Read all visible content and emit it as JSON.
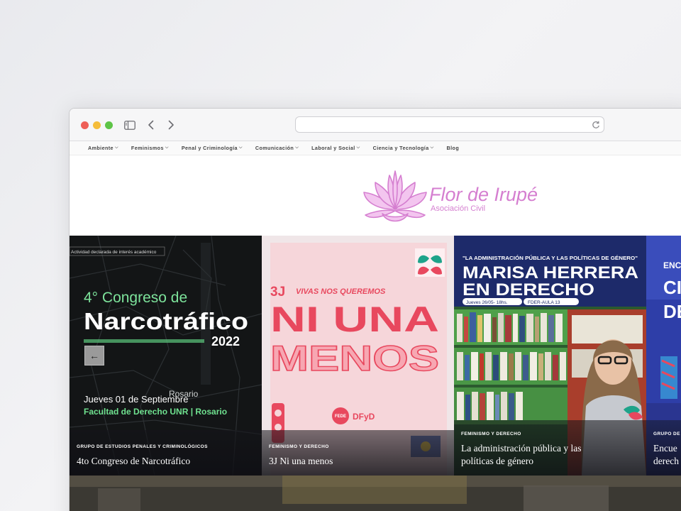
{
  "browser": {
    "url_placeholder": ""
  },
  "nav": {
    "items": [
      {
        "label": "Ambiente",
        "dropdown": true
      },
      {
        "label": "Feminismos",
        "dropdown": true
      },
      {
        "label": "Penal y Criminología",
        "dropdown": true
      },
      {
        "label": "Comunicación",
        "dropdown": true
      },
      {
        "label": "Laboral y Social",
        "dropdown": true
      },
      {
        "label": "Ciencia y Tecnología",
        "dropdown": true
      },
      {
        "label": "Blog",
        "dropdown": false
      }
    ]
  },
  "header": {
    "logo_title": "Flor de Irupé",
    "logo_subtitle": "Asociación Civil"
  },
  "cards": [
    {
      "badge": "Actividad declarada de interés académico",
      "poster_line1": "4° Congreso de",
      "poster_line2": "Narcotráfico",
      "poster_year": "2022",
      "poster_date": "Jueves 01 de Septiembre",
      "poster_place": "Facultad de Derecho UNR | Rosario",
      "map_city": "Rosario",
      "category": "GRUPO DE ESTUDIOS PENALES Y CRIMINOLÓGICOS",
      "title": "4to Congreso de Narcotráfico"
    },
    {
      "poster_tag": "3J",
      "poster_sub": "VIVAS NOS QUEREMOS",
      "poster_line1": "NI UNA",
      "poster_line2": "MENOS",
      "poster_logo1": "FEDE",
      "poster_logo2": "DFyD",
      "category": "FEMINISMO Y DERECHO",
      "title": "3J Ni una menos"
    },
    {
      "poster_header": "\"LA ADMINISTRACIÓN PÚBLICA Y LAS POLÍTICAS DE GÉNERO\"",
      "poster_line1": "MARISA HERRERA",
      "poster_line2": "EN DERECHO",
      "poster_date": "Jueves 26/05- 18hs.",
      "poster_place": "FDER-AULA 13",
      "category": "FEMINISMO Y DERECHO",
      "title_line1": "La administración pública y las",
      "title_line2": "políticas de género"
    },
    {
      "poster_line1": "ENC",
      "poster_line2": "CI",
      "poster_line3": "DE",
      "category": "GRUPO DE",
      "title_line1": "Encue",
      "title_line2": "derech"
    }
  ],
  "colors": {
    "logo": "#d57fd0",
    "card3_bg": "#1d2a6a",
    "card2_red": "#e8485e"
  }
}
